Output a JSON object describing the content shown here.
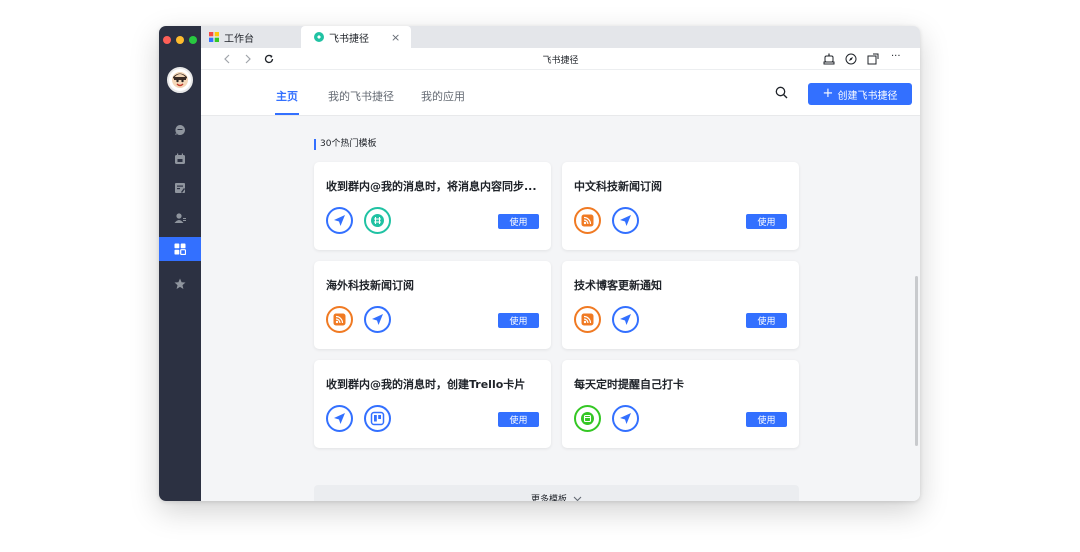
{
  "tabs": [
    {
      "label": "工作台",
      "icon": "grid-app-icon"
    },
    {
      "label": "飞书捷径",
      "icon": "shortcut-app-icon",
      "close": "×"
    }
  ],
  "address": {
    "title": "飞书捷径",
    "back_icon": "chevron-left-icon",
    "forward_icon": "chevron-right-icon",
    "reload_icon": "reload-icon",
    "more": "···"
  },
  "nav": {
    "tabs": [
      "主页",
      "我的飞书捷径",
      "我的应用"
    ],
    "create_button": "创建飞书捷径",
    "create_plus": "+"
  },
  "section_title": "30个热门模板",
  "templates": [
    {
      "title": "收到群内@我的消息时，将消息内容同步...",
      "icons": [
        "send-icon",
        "hash-icon"
      ],
      "action": "使用"
    },
    {
      "title": "中文科技新闻订阅",
      "icons": [
        "rss-icon",
        "send-icon"
      ],
      "action": "使用"
    },
    {
      "title": "海外科技新闻订阅",
      "icons": [
        "rss-icon",
        "send-icon"
      ],
      "action": "使用"
    },
    {
      "title": "技术博客更新通知",
      "icons": [
        "rss-icon",
        "send-icon"
      ],
      "action": "使用"
    },
    {
      "title": "收到群内@我的消息时，创建Trello卡片",
      "icons": [
        "send-icon",
        "trello-icon"
      ],
      "action": "使用"
    },
    {
      "title": "每天定时提醒自己打卡",
      "icons": [
        "calendar-icon",
        "send-icon"
      ],
      "action": "使用"
    }
  ],
  "more_templates": "更多模板",
  "colors": {
    "accent": "#3370ff",
    "send": "#3370ff",
    "hash": "#20c2a3",
    "rss": "#f07a23",
    "calendar": "#34c724",
    "trello": "#3370ff",
    "rail": "#2c3142"
  }
}
